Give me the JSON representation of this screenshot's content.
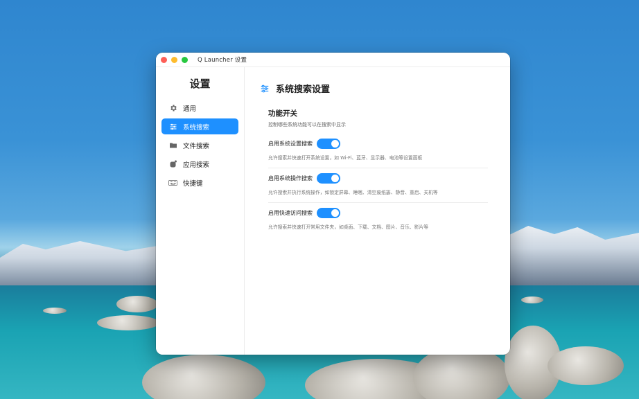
{
  "window": {
    "title": "Q Launcher 设置"
  },
  "sidebar": {
    "title": "设置",
    "items": [
      {
        "label": "通用",
        "icon": "gear-icon"
      },
      {
        "label": "系统搜索",
        "icon": "sliders-icon",
        "active": true
      },
      {
        "label": "文件搜索",
        "icon": "folder-icon"
      },
      {
        "label": "应用搜索",
        "icon": "app-icon"
      },
      {
        "label": "快捷键",
        "icon": "keyboard-icon"
      }
    ]
  },
  "main": {
    "title": "系统搜索设置",
    "section": {
      "title": "功能开关",
      "description": "控制哪些系统功能可以在搜索中显示",
      "options": [
        {
          "label": "启用系统设置搜索",
          "enabled": true,
          "description": "允许搜索并快速打开系统设置，如 Wi-Fi、蓝牙、显示器、电池等设置面板"
        },
        {
          "label": "启用系统操作搜索",
          "enabled": true,
          "description": "允许搜索并执行系统操作，如锁定屏幕、睡眠、清空废纸篓、静音、重启、关机等"
        },
        {
          "label": "启用快速访问搜索",
          "enabled": true,
          "description": "允许搜索并快速打开常用文件夹，如桌面、下载、文档、图片、音乐、影片等"
        }
      ]
    }
  },
  "colors": {
    "accent": "#1e90ff"
  }
}
